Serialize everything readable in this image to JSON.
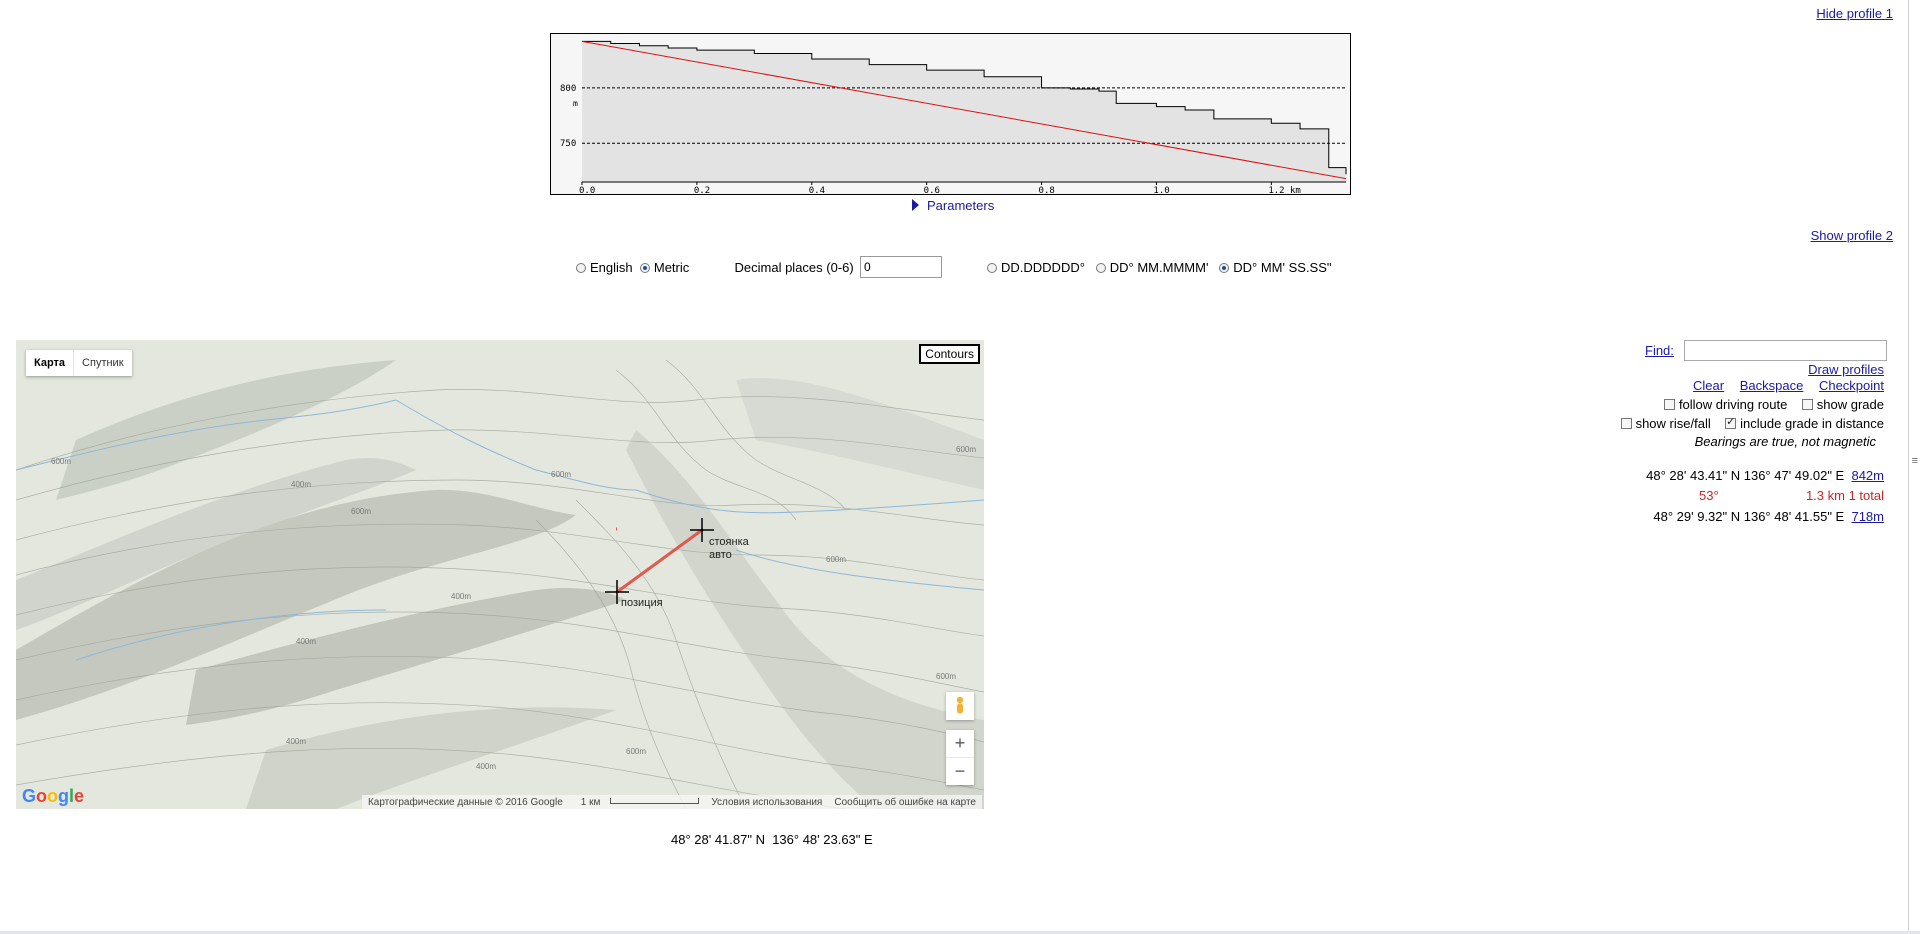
{
  "profile": {
    "hide_link": "Hide profile 1",
    "show_link": "Show profile 2",
    "params_label": "Parameters",
    "y_ticks": [
      "800",
      "750"
    ],
    "y_unit": "m",
    "x_ticks": [
      "0.0",
      "0.2",
      "0.4",
      "0.6",
      "0.8",
      "1.0",
      "1.2 km"
    ],
    "chart_data": {
      "type": "area",
      "x": [
        0.0,
        0.05,
        0.1,
        0.15,
        0.2,
        0.3,
        0.4,
        0.5,
        0.6,
        0.7,
        0.8,
        0.85,
        0.9,
        0.93,
        1.0,
        1.05,
        1.1,
        1.2,
        1.25,
        1.3,
        1.33
      ],
      "y": [
        842,
        840,
        838,
        836,
        834,
        831,
        826,
        821,
        816,
        810,
        800,
        799,
        797,
        786,
        783,
        780,
        772,
        768,
        763,
        728,
        722
      ],
      "straight_line": {
        "x": [
          0.0,
          1.33
        ],
        "y": [
          842,
          718
        ]
      },
      "xlim": [
        0,
        1.33
      ],
      "ylim": [
        715,
        845
      ],
      "grid_y": [
        800,
        750
      ]
    }
  },
  "options": {
    "english": "English",
    "metric": "Metric",
    "decimal_label": "Decimal places (0-6)",
    "decimal_value": "0",
    "fmt_dd": "DD.DDDDDD°",
    "fmt_ddmm": "DD° MM.MMMM'",
    "fmt_ddmmss": "DD° MM' SS.SS\""
  },
  "map": {
    "tab_map": "Карта",
    "tab_satellite": "Спутник",
    "contours": "Contours",
    "marker_a": "стоянка\nавто",
    "marker_b": "позиция",
    "zoom_in": "+",
    "zoom_out": "−",
    "logo": "Google",
    "attribution": "Картографические данные © 2016 Google",
    "scale": "1 км",
    "terms": "Условия использования",
    "report": "Сообщить об ошибке на карте",
    "contour_labels": [
      "600m",
      "400m",
      "600m",
      "400m",
      "600m",
      "400m",
      "600m",
      "600m",
      "400m",
      "600m",
      "600m",
      "400m"
    ]
  },
  "center_coord": "48° 28' 41.87\" N  136° 48' 23.63\" E",
  "panel": {
    "find_label": "Find:",
    "draw_profiles": "Draw profiles",
    "clear": "Clear",
    "backspace": "Backspace",
    "checkpoint": "Checkpoint",
    "follow_route": "follow driving route",
    "show_grade": "show grade",
    "show_rise": "show rise/fall",
    "include_grade": "include grade in distance",
    "bearing_note": "Bearings are true, not magnetic",
    "pt1_coord": "48° 28' 43.41\" N 136° 47' 49.02\" E",
    "pt1_elev": "842m",
    "bearing": "53°",
    "distance": "1.3 km 1 total",
    "pt2_coord": "48° 29' 9.32\" N 136° 48' 41.55\" E",
    "pt2_elev": "718m"
  },
  "colors": {
    "link": "#1a1aa6",
    "route_red": "#e05a4e",
    "bearing_red": "#c62828"
  }
}
